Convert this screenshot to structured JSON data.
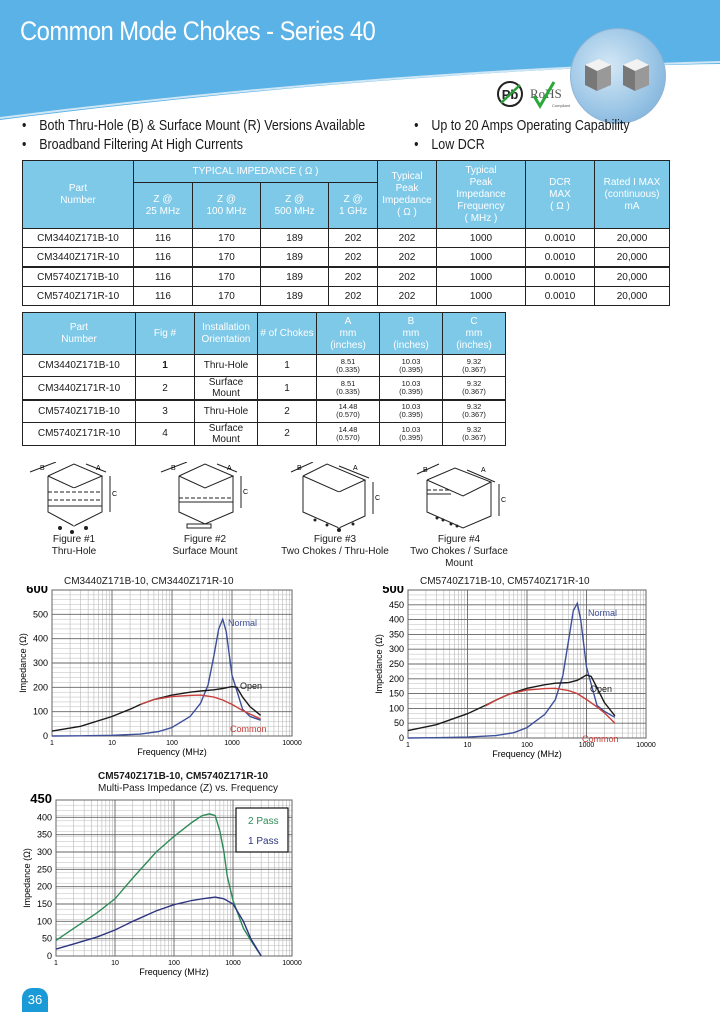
{
  "header": {
    "title": "Common Mode Chokes - Series 40",
    "badges": [
      "Pb",
      "RoHS"
    ],
    "badge_subtext": "Compliant",
    "brand_color": "#5ab2e6"
  },
  "features": [
    "Both Thru-Hole (B) & Surface Mount (R) Versions Available",
    "Up to 20 Amps Operating Capability",
    "Broadband Filtering At High Currents",
    "Low DCR"
  ],
  "impedance_table": {
    "group_header": "TYPICAL IMPEDANCE ( Ω )",
    "headers": [
      "Part Number",
      "Z @ 25 MHz",
      "Z @ 100 MHz",
      "Z @ 500 MHz",
      "Z @ 1 GHz",
      "Typical Peak Impedance ( Ω )",
      "Typical Peak Impedance Frequency ( MHz )",
      "DCR MAX ( Ω )",
      "Rated I MAX (continuous) mA"
    ],
    "header_lines": [
      [
        "Part",
        "Number"
      ],
      [
        "Z @",
        "25 MHz"
      ],
      [
        "Z @",
        "100 MHz"
      ],
      [
        "Z @",
        "500 MHz"
      ],
      [
        "Z @",
        "1 GHz"
      ],
      [
        "Typical",
        "Peak",
        "Impedance",
        "( Ω )"
      ],
      [
        "Typical",
        "Peak",
        "Impedance",
        "Frequency",
        "( MHz )"
      ],
      [
        "DCR",
        "MAX",
        "( Ω )"
      ],
      [
        "Rated I MAX",
        "(continuous)",
        "mA"
      ]
    ],
    "rows": [
      [
        "CM3440Z171B-10",
        "116",
        "170",
        "189",
        "202",
        "202",
        "1000",
        "0.0010",
        "20,000"
      ],
      [
        "CM3440Z171R-10",
        "116",
        "170",
        "189",
        "202",
        "202",
        "1000",
        "0.0010",
        "20,000"
      ],
      [
        "CM5740Z171B-10",
        "116",
        "170",
        "189",
        "202",
        "202",
        "1000",
        "0.0010",
        "20,000"
      ],
      [
        "CM5740Z171R-10",
        "116",
        "170",
        "189",
        "202",
        "202",
        "1000",
        "0.0010",
        "20,000"
      ]
    ]
  },
  "dimension_table": {
    "header_lines": [
      [
        "Part",
        "Number"
      ],
      [
        "Fig #"
      ],
      [
        "Installation",
        "Orientation"
      ],
      [
        "# of Chokes"
      ],
      [
        "A",
        "mm",
        "(inches)"
      ],
      [
        "B",
        "mm",
        "(inches)"
      ],
      [
        "C",
        "mm",
        "(inches)"
      ]
    ],
    "rows": [
      {
        "part": "CM3440Z171B-10",
        "fig": "1",
        "orientation": "Thru-Hole",
        "chokes": "1",
        "a_mm": "8.51",
        "a_in": "(0.335)",
        "b_mm": "10.03",
        "b_in": "(0.395)",
        "c_mm": "9.32",
        "c_in": "(0.367)"
      },
      {
        "part": "CM3440Z171R-10",
        "fig": "2",
        "orientation": "Surface Mount",
        "chokes": "1",
        "a_mm": "8.51",
        "a_in": "(0.335)",
        "b_mm": "10.03",
        "b_in": "(0.395)",
        "c_mm": "9.32",
        "c_in": "(0.367)"
      },
      {
        "part": "CM5740Z171B-10",
        "fig": "3",
        "orientation": "Thru-Hole",
        "chokes": "2",
        "a_mm": "14.48",
        "a_in": "(0.570)",
        "b_mm": "10.03",
        "b_in": "(0.395)",
        "c_mm": "9.32",
        "c_in": "(0.367)"
      },
      {
        "part": "CM5740Z171R-10",
        "fig": "4",
        "orientation": "Surface Mount",
        "chokes": "2",
        "a_mm": "14.48",
        "a_in": "(0.570)",
        "b_mm": "10.03",
        "b_in": "(0.395)",
        "c_mm": "9.32",
        "c_in": "(0.367)"
      }
    ]
  },
  "figures": [
    {
      "label": "Figure #1",
      "caption": "Thru-Hole",
      "dims": [
        "A",
        "B",
        "C"
      ]
    },
    {
      "label": "Figure #2",
      "caption": "Surface Mount",
      "dims": [
        "A",
        "B",
        "C"
      ]
    },
    {
      "label": "Figure #3",
      "caption": "Two Chokes / Thru-Hole",
      "dims": [
        "A",
        "B",
        "C"
      ]
    },
    {
      "label": "Figure #4",
      "caption": "Two Chokes / Surface Mount",
      "dims": [
        "A",
        "B",
        "C"
      ]
    }
  ],
  "chart_data": [
    {
      "type": "line",
      "title": "CM3440Z171B-10, CM3440Z171R-10",
      "xlabel": "Frequency (MHz)",
      "ylabel": "Impedance (Ω)",
      "xscale": "log",
      "xlim": [
        1,
        10000
      ],
      "ylim": [
        0,
        600
      ],
      "xticks": [
        "1",
        "10",
        "100",
        "1000",
        "10000"
      ],
      "yticks": [
        "0",
        "100",
        "200",
        "300",
        "400",
        "500",
        "600"
      ],
      "grid": true,
      "series": [
        {
          "name": "Normal",
          "color": "#3d4f9a",
          "label_pos": "top-right",
          "x": [
            1,
            3,
            10,
            30,
            60,
            100,
            200,
            300,
            400,
            500,
            600,
            700,
            800,
            1000,
            1500,
            2000,
            3000
          ],
          "y": [
            0,
            1,
            3,
            8,
            18,
            35,
            80,
            135,
            210,
            330,
            440,
            480,
            430,
            250,
            110,
            80,
            65
          ]
        },
        {
          "name": "Open",
          "color": "#1a1a1a",
          "label_pos": "right",
          "x": [
            1,
            3,
            10,
            20,
            30,
            50,
            100,
            200,
            300,
            500,
            700,
            1000,
            1200,
            1500,
            2000,
            3000
          ],
          "y": [
            20,
            40,
            80,
            110,
            130,
            150,
            168,
            180,
            185,
            190,
            195,
            203,
            200,
            160,
            120,
            85
          ]
        },
        {
          "name": "Common",
          "color": "#c8413c",
          "label_pos": "bottom-right",
          "x": [
            30,
            50,
            100,
            200,
            300,
            500,
            700,
            1000,
            1500,
            2000,
            3000
          ],
          "y": [
            130,
            150,
            162,
            167,
            168,
            160,
            148,
            130,
            105,
            90,
            70
          ]
        }
      ]
    },
    {
      "type": "line",
      "title": "CM5740Z171B-10, CM5740Z171R-10",
      "xlabel": "Frequency (MHz)",
      "ylabel": "Impedance (Ω)",
      "xscale": "log",
      "xlim": [
        1,
        10000
      ],
      "ylim": [
        0,
        500
      ],
      "xticks": [
        "1",
        "10",
        "100",
        "1000",
        "10000"
      ],
      "yticks": [
        "0",
        "50",
        "100",
        "150",
        "200",
        "250",
        "300",
        "350",
        "400",
        "450",
        "500"
      ],
      "grid": true,
      "series": [
        {
          "name": "Normal",
          "color": "#3d4f9a",
          "label_pos": "top-right",
          "x": [
            1,
            3,
            10,
            30,
            60,
            100,
            200,
            300,
            400,
            500,
            600,
            700,
            800,
            1000,
            1500,
            2000,
            3000
          ],
          "y": [
            0,
            1,
            3,
            8,
            18,
            35,
            80,
            130,
            210,
            330,
            430,
            455,
            400,
            240,
            110,
            90,
            70
          ]
        },
        {
          "name": "Open",
          "color": "#1a1a1a",
          "label_pos": "right",
          "x": [
            1,
            3,
            10,
            20,
            30,
            50,
            100,
            200,
            300,
            500,
            700,
            1000,
            1200,
            1500,
            2000,
            3000
          ],
          "y": [
            25,
            45,
            82,
            110,
            128,
            148,
            168,
            180,
            185,
            187,
            195,
            213,
            208,
            170,
            120,
            75
          ]
        },
        {
          "name": "Common",
          "color": "#c8413c",
          "label_pos": "bottom-right",
          "x": [
            20,
            30,
            50,
            100,
            200,
            300,
            500,
            700,
            1000,
            1500,
            2000,
            3000
          ],
          "y": [
            108,
            128,
            148,
            162,
            167,
            168,
            160,
            150,
            130,
            105,
            85,
            50
          ]
        }
      ]
    },
    {
      "type": "line",
      "title": "CM5740Z171B-10, CM5740Z171R-10",
      "subtitle": "Multi-Pass Impedance (Z) vs. Frequency",
      "xlabel": "Frequency (MHz)",
      "ylabel": "Impedance (Ω)",
      "xscale": "log",
      "xlim": [
        1,
        10000
      ],
      "ylim": [
        0,
        450
      ],
      "xticks": [
        "1",
        "10",
        "100",
        "1000",
        "10000"
      ],
      "yticks": [
        "0",
        "50",
        "100",
        "150",
        "200",
        "250",
        "300",
        "350",
        "400",
        "450"
      ],
      "grid": true,
      "legend": "top-right",
      "series": [
        {
          "name": "2 Pass",
          "color": "#2e8b57",
          "x": [
            1,
            2,
            5,
            10,
            20,
            50,
            100,
            200,
            300,
            400,
            500,
            600,
            700,
            800,
            1000,
            1500,
            2000,
            3000
          ],
          "y": [
            45,
            80,
            125,
            165,
            225,
            300,
            345,
            385,
            405,
            410,
            405,
            360,
            300,
            230,
            160,
            80,
            45,
            0
          ]
        },
        {
          "name": "1 Pass",
          "color": "#2d3580",
          "x": [
            1,
            2,
            5,
            10,
            20,
            50,
            100,
            200,
            300,
            500,
            700,
            1000,
            1500,
            2000,
            3000
          ],
          "y": [
            20,
            35,
            55,
            75,
            100,
            130,
            148,
            160,
            165,
            170,
            165,
            150,
            100,
            50,
            0
          ]
        }
      ]
    }
  ],
  "page_number": "36"
}
